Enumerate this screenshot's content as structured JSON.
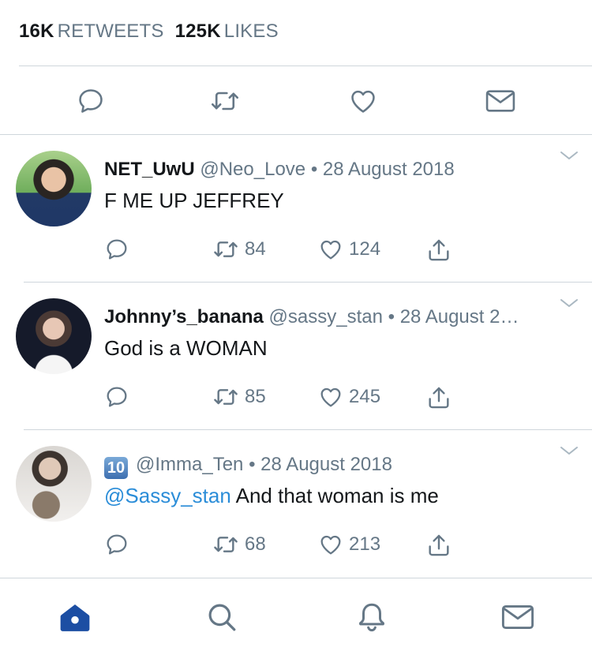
{
  "stats": {
    "retweets_count": "16K",
    "retweets_label": "RETWEETS",
    "likes_count": "125K",
    "likes_label": "LIKES"
  },
  "colors": {
    "accent": "#2b8dd8",
    "icon": "#657786",
    "tab_active": "#1c4ea3",
    "divider": "#cfd6dc"
  },
  "action_bar": {
    "icons": [
      "reply-icon",
      "retweet-icon",
      "like-icon",
      "message-icon"
    ]
  },
  "replies": [
    {
      "name": "NET_UwU",
      "handle": "@Neo_Love",
      "separator": "•",
      "date": "28 August 2018",
      "text": "F ME UP JEFFREY",
      "retweets": "84",
      "likes": "124"
    },
    {
      "name": "Johnny’s_banana",
      "handle": "@sassy_stan",
      "separator": "•",
      "date": "28 August 2…",
      "text": "God is a WOMAN",
      "retweets": "85",
      "likes": "245"
    },
    {
      "name_badge": "10",
      "handle": "@Imma_Ten",
      "separator": "•",
      "date": "28 August 2018",
      "mention": "@Sassy_stan",
      "text": "And that woman is me",
      "retweets": "68",
      "likes": "213"
    }
  ],
  "tabs": [
    "home-icon",
    "search-icon",
    "notifications-icon",
    "messages-icon"
  ]
}
